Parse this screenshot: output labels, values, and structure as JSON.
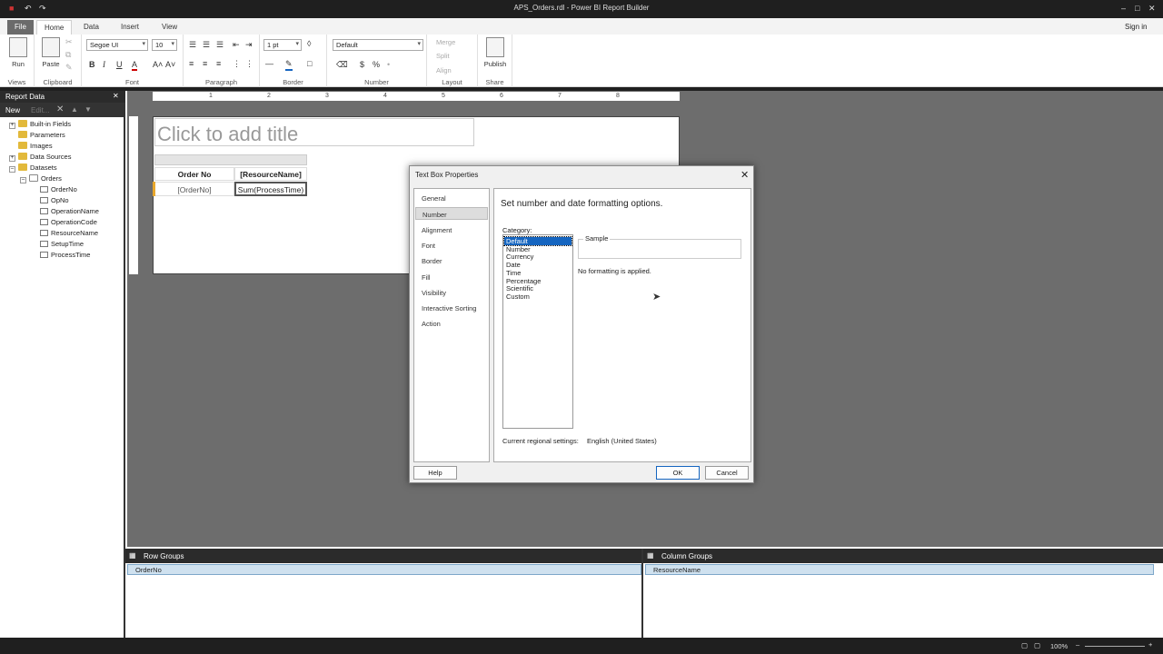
{
  "window": {
    "title": "APS_Orders.rdl - Power BI Report Builder",
    "sign_in": "Sign in",
    "minimize": "–",
    "restore": "□",
    "close": "✕"
  },
  "quick_access": {
    "save_icon": "save-icon",
    "undo_icon": "undo-icon",
    "redo_icon": "redo-icon"
  },
  "menu": {
    "tabs": [
      "File",
      "Home",
      "Data",
      "Insert",
      "View"
    ]
  },
  "ribbon": {
    "views": {
      "run": "Run",
      "label": "Views"
    },
    "clipboard": {
      "paste": "Paste",
      "label": "Clipboard"
    },
    "font": {
      "family": "Segoe UI",
      "size": "10",
      "label": "Font",
      "bold": "B",
      "italic": "I",
      "underline": "U",
      "color": "A",
      "grow": "A˄",
      "shrink": "A˅"
    },
    "paragraph": {
      "label": "Paragraph"
    },
    "border": {
      "width": "1 pt",
      "label": "Border"
    },
    "number": {
      "format": "Default",
      "label": "Number",
      "currency": "$",
      "percent": "%"
    },
    "layout": {
      "merge": "Merge",
      "split": "Split",
      "align": "Align",
      "label": "Layout"
    },
    "share": {
      "publish": "Publish",
      "label": "Share"
    }
  },
  "report_data": {
    "title": "Report Data",
    "close": "✕",
    "new": "New",
    "edit": "Edit...",
    "tree": [
      {
        "label": "Built-in Fields",
        "kind": "folder",
        "expander": "+"
      },
      {
        "label": "Parameters",
        "kind": "folder",
        "expander": ""
      },
      {
        "label": "Images",
        "kind": "folder",
        "expander": ""
      },
      {
        "label": "Data Sources",
        "kind": "folder",
        "expander": "+"
      },
      {
        "label": "Datasets",
        "kind": "folder",
        "expander": "–"
      },
      {
        "label": "Orders",
        "kind": "dataset",
        "expander": "–"
      },
      {
        "label": "OrderNo",
        "kind": "field"
      },
      {
        "label": "OpNo",
        "kind": "field"
      },
      {
        "label": "OperationName",
        "kind": "field"
      },
      {
        "label": "OperationCode",
        "kind": "field"
      },
      {
        "label": "ResourceName",
        "kind": "field"
      },
      {
        "label": "SetupTime",
        "kind": "field"
      },
      {
        "label": "ProcessTime",
        "kind": "field"
      }
    ]
  },
  "ruler": {
    "marks": [
      "1",
      "2",
      "3",
      "4",
      "5",
      "6",
      "7",
      "8"
    ]
  },
  "report": {
    "title_placeholder": "Click to add title",
    "header_order": "Order No",
    "header_resource": "[ResourceName]",
    "cell_order": "[OrderNo]",
    "cell_process": "Sum(ProcessTime)"
  },
  "dialog": {
    "title": "Text Box Properties",
    "close": "✕",
    "nav": [
      "General",
      "Number",
      "Alignment",
      "Font",
      "Border",
      "Fill",
      "Visibility",
      "Interactive Sorting",
      "Action"
    ],
    "selected_nav": "Number",
    "heading": "Set number and date formatting options.",
    "category_label": "Category:",
    "categories": [
      "Default",
      "Number",
      "Currency",
      "Date",
      "Time",
      "Percentage",
      "Scientific",
      "Custom"
    ],
    "selected_category": "Default",
    "sample_label": "Sample",
    "no_format": "No formatting is applied.",
    "regional_label": "Current regional settings:",
    "regional_value": "English (United States)",
    "help": "Help",
    "ok": "OK",
    "cancel": "Cancel"
  },
  "groups": {
    "row_title": "Row Groups",
    "row_field": "OrderNo",
    "column_title": "Column Groups",
    "column_field": "ResourceName"
  },
  "status": {
    "zoom": "100%"
  },
  "colors": {
    "accent": "#1565c0",
    "titlebar": "#1f1f1f",
    "design_bg": "#6d6d6d",
    "folder": "#e2b93b"
  }
}
